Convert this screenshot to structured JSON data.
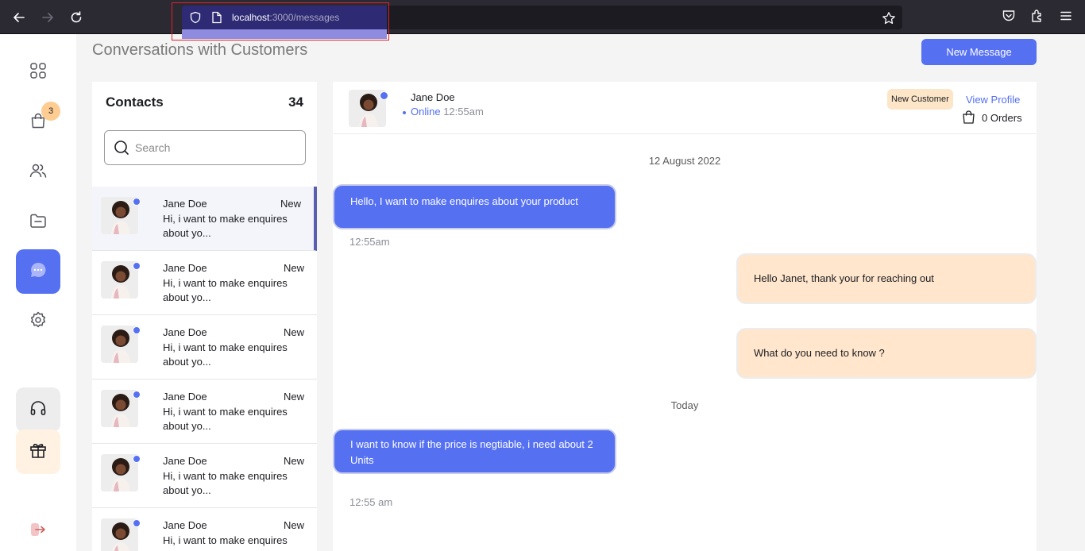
{
  "browser": {
    "url_host": "localhost",
    "url_path": ":3000/messages"
  },
  "page": {
    "title": "Conversations with Customers",
    "new_message_label": "New Message"
  },
  "nav": {
    "cart_badge": "3"
  },
  "contacts": {
    "title": "Contacts",
    "count": "34",
    "search_placeholder": "Search",
    "items": [
      {
        "name": "Jane Doe",
        "tag": "New",
        "preview": "Hi, i want to make enquires about yo..."
      },
      {
        "name": "Jane Doe",
        "tag": "New",
        "preview": "Hi, i want to make enquires about yo..."
      },
      {
        "name": "Jane Doe",
        "tag": "New",
        "preview": "Hi, i want to make enquires about yo..."
      },
      {
        "name": "Jane Doe",
        "tag": "New",
        "preview": "Hi, i want to make enquires about yo..."
      },
      {
        "name": "Jane Doe",
        "tag": "New",
        "preview": "Hi, i want to make enquires about yo..."
      },
      {
        "name": "Jane Doe",
        "tag": "New",
        "preview": "Hi, i want to make enquires"
      }
    ]
  },
  "chat": {
    "name": "Jane Doe",
    "status": "Online",
    "status_time": "12:55am",
    "customer_badge": "New Customer",
    "view_profile": "View Profile",
    "orders": "0 Orders",
    "date1": "12 August 2022",
    "msg1": "Hello, I want to make enquires about your product",
    "msg1_time": "12:55am",
    "msg2": "Hello Janet, thank your for reaching out",
    "msg3": "What do you need to know ?",
    "date2": "Today",
    "msg4": "I want to know if the price is negtiable, i need about 2 Units",
    "msg4_time": "12:55 am"
  }
}
